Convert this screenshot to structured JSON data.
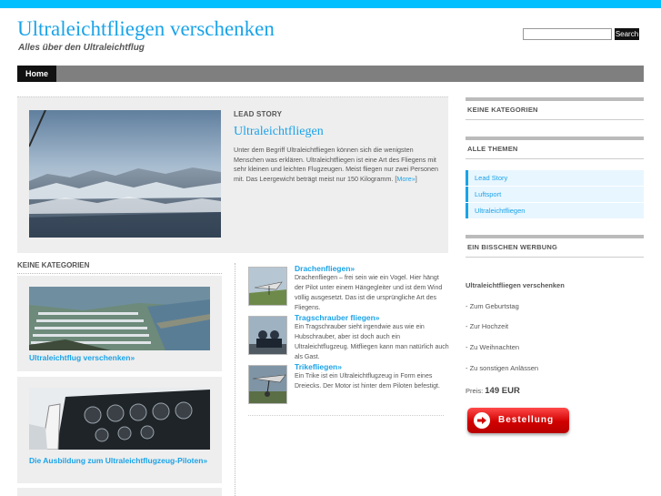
{
  "header": {
    "site_title": "Ultraleichtfliegen verschenken",
    "tagline": "Alles über den Ultraleichtflug",
    "search_placeholder": "",
    "search_button": "Search"
  },
  "nav": {
    "items": [
      {
        "label": "Home"
      }
    ]
  },
  "lead_story": {
    "section_label": "Lead Story",
    "title": "Ultraleichtfliegen",
    "body": "Unter dem Begriff Ultraleichtfliegen können sich die wenigsten Menschen was erklären. Ultraleichtfliegen ist eine Art des Fliegens mit sehr kleinen und leichten Flugzeugen. Meist fliegen nur zwei Personen mit. Das Leergewicht beträgt meist nur 150 Kilogramm.",
    "more_open": "[",
    "more_link": "More»",
    "more_close": "]"
  },
  "category": {
    "label": "Keine Kategorien",
    "cards": [
      {
        "title": "Ultraleichtflug verschenken»"
      },
      {
        "title": "Die Ausbildung zum Ultraleichtflugzeug-Piloten»"
      }
    ]
  },
  "articles": [
    {
      "title": "Drachenfliegen»",
      "body": "Drachenfliegen – frei sein wie ein Vogel. Hier hängt der Pilot unter einem Hängegleiter und ist dem Wind völlig ausgesetzt. Das ist die ursprüngliche Art des Fliegens."
    },
    {
      "title": "Tragschrauber fliegen»",
      "body": "Ein Tragschrauber sieht irgendwie aus wie ein Hubschrauber, aber ist doch auch ein Ultraleichtflugzeug. Mitfliegen kann man natürlich auch als Gast."
    },
    {
      "title": "Trikefliegen»",
      "body": "Ein Trike ist ein Ultraleichtflugzeug in Form eines Dreiecks. Der Motor ist hinter dem Piloten befestigt."
    }
  ],
  "sidebar": {
    "keine_kategorien": "Keine Kategorien",
    "alle_themen": "Alle Themen",
    "themes": [
      {
        "label": "Lead Story"
      },
      {
        "label": "Luftsport"
      },
      {
        "label": "Ultraleichtfliegen"
      }
    ],
    "werbung_label": "Ein bisschen Werbung",
    "promo_title": "Ultraleichtfliegen verschenken",
    "promo_items": [
      "- Zum Geburtstag",
      "- Zur Hochzeit",
      "- Zu Weihnachten",
      "- Zu sonstigen Anlässen"
    ],
    "price_label": "Preis:",
    "price_value": "149 EUR",
    "order_button": "Bestellung"
  },
  "colors": {
    "accent": "#1aa3e8",
    "topbar": "#00bfff",
    "nav": "#7f7f7f",
    "order": "#d10000"
  }
}
